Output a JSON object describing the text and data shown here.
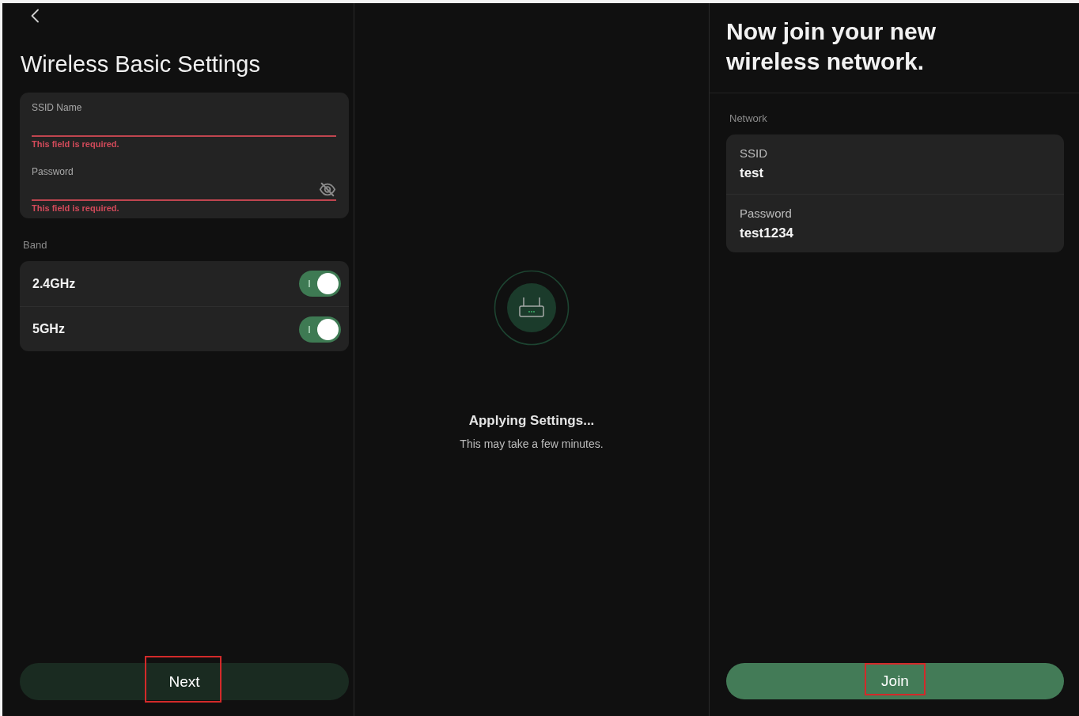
{
  "basic_settings": {
    "title": "Wireless Basic Settings",
    "fields": [
      {
        "kind": "text",
        "label": "SSID Name",
        "error": "This field is required."
      },
      {
        "kind": "password",
        "label": "Password",
        "error": "This field is required."
      }
    ],
    "band": {
      "heading": "Band",
      "items": [
        {
          "label": "2.4GHz",
          "on": true
        },
        {
          "label": "5GHz",
          "on": true
        }
      ]
    },
    "button": {
      "label": "Next",
      "disabled": true,
      "highlighted": true
    }
  },
  "applying": {
    "title": "Applying Settings...",
    "subtitle": "This may take a few minutes."
  },
  "join_network": {
    "title": "Now join your new wireless network.",
    "section": "Network",
    "items": [
      {
        "label": "SSID",
        "value": "test"
      },
      {
        "label": "Password",
        "value": "test1234"
      }
    ],
    "button": {
      "label": "Join",
      "disabled": false,
      "highlighted": true
    }
  }
}
